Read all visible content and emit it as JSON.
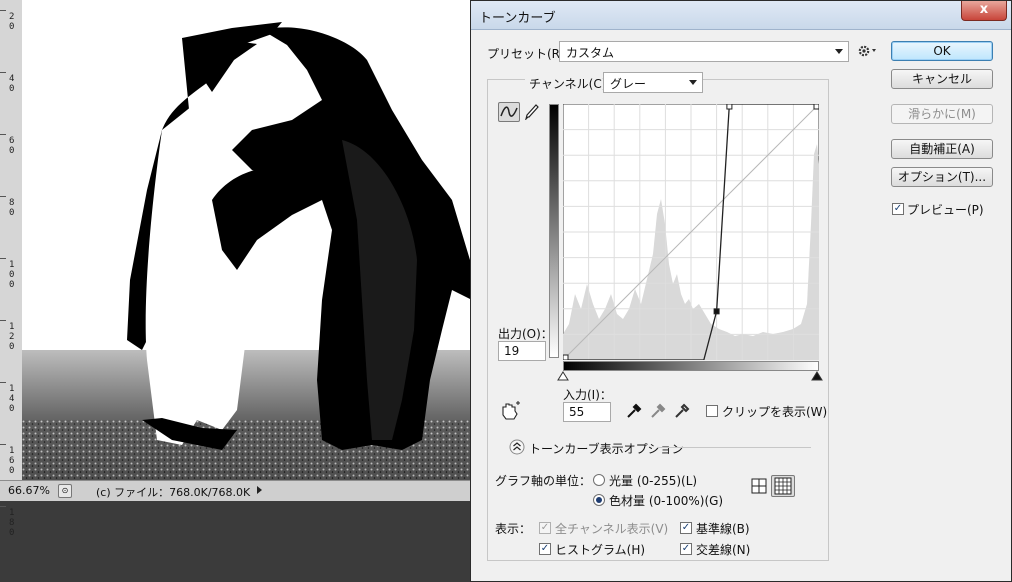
{
  "workspace": {
    "ruler_marks": [
      "2\n0",
      "4\n0",
      "6\n0",
      "8\n0",
      "1\n0\n0",
      "1\n2\n0",
      "1\n4\n0",
      "1\n6\n0",
      "1\n8\n0"
    ],
    "status": {
      "zoom": "66.67%",
      "file_info": "(c) ファイル：768.0K/768.0K"
    }
  },
  "dialog": {
    "title": "トーンカーブ",
    "close_symbol": "x",
    "preset": {
      "label": "プリセット(R)：",
      "value": "カスタム"
    },
    "channel": {
      "label": "チャンネル(C)：",
      "value": "グレー"
    },
    "output": {
      "label": "出力(O)：",
      "value": "19"
    },
    "input": {
      "label": "入力(I)：",
      "value": "55"
    },
    "show_clipping": {
      "label": "クリップを表示(W)",
      "checked": false
    },
    "options_title": "トーンカーブ表示オプション",
    "units": {
      "label": "グラフ軸の単位：",
      "options": [
        {
          "label": "光量 (0-255)(L)",
          "selected": false
        },
        {
          "label": "色材量 (0-100%)(G)",
          "selected": true
        }
      ]
    },
    "display": {
      "label": "表示：",
      "all_channels": {
        "label": "全チャンネル表示(V)",
        "checked": true,
        "disabled": true
      },
      "baseline": {
        "label": "基準線(B)",
        "checked": true
      },
      "histogram": {
        "label": "ヒストグラム(H)",
        "checked": true
      },
      "intersection": {
        "label": "交差線(N)",
        "checked": true
      }
    },
    "buttons": {
      "ok": "OK",
      "cancel": "キャンセル",
      "smooth": "滑らかに(M)",
      "auto": "自動補正(A)",
      "options": "オプション(T)..."
    },
    "preview": {
      "label": "プレビュー(P)",
      "checked": true
    },
    "curve_points": [
      [
        0,
        0
      ],
      [
        55,
        0
      ],
      [
        60,
        19
      ],
      [
        65,
        100
      ],
      [
        100,
        100
      ]
    ],
    "colors": {
      "accent": "#3c7fb1",
      "close": "#c8453a",
      "histogram": "#d9d9d9"
    }
  }
}
